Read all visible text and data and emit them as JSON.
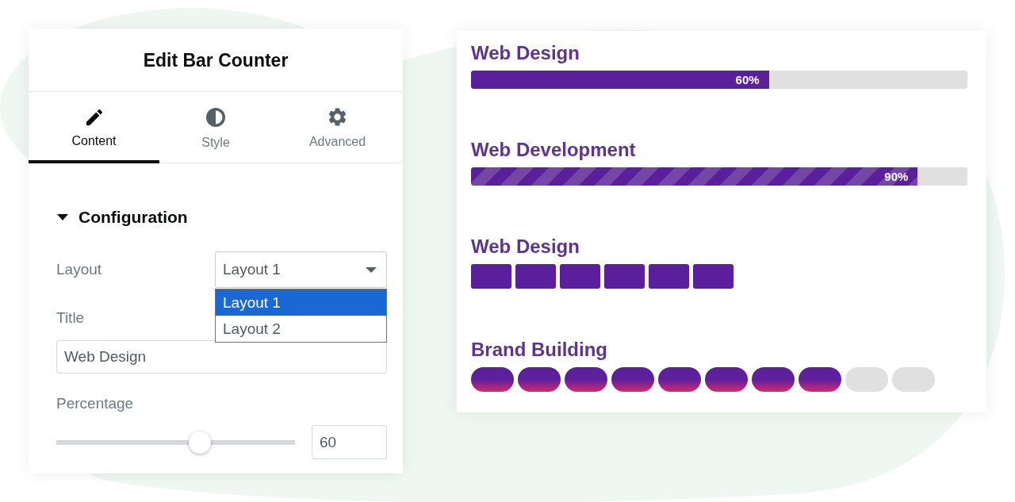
{
  "panel": {
    "title": "Edit Bar Counter",
    "tabs": [
      {
        "label": "Content",
        "selected": true
      },
      {
        "label": "Style",
        "selected": false
      },
      {
        "label": "Advanced",
        "selected": false
      }
    ],
    "section": {
      "title": "Configuration",
      "expanded": true,
      "fields": [
        {
          "kind": "select",
          "label": "Layout",
          "value": "Layout 1",
          "expanded": true,
          "options": [
            {
              "label": "Layout 1",
              "selected": true
            },
            {
              "label": "Layout 2",
              "selected": false
            }
          ]
        },
        {
          "kind": "text",
          "label": "Title",
          "value": "Web Design"
        },
        {
          "kind": "slider",
          "label": "Percentage",
          "level": 0.6,
          "value": "60"
        }
      ]
    }
  },
  "preview": {
    "bars": [
      {
        "kind": "solid",
        "title": "Web Design",
        "level": 0.6,
        "reading": "60%"
      },
      {
        "kind": "striped",
        "title": "Web Development",
        "level": 0.9,
        "reading": "90%"
      },
      {
        "kind": "blocks",
        "title": "Web Design",
        "segments": [
          {
            "filled": true
          },
          {
            "filled": true
          },
          {
            "filled": true
          },
          {
            "filled": true
          },
          {
            "filled": true
          },
          {
            "filled": true
          }
        ]
      },
      {
        "kind": "pills",
        "title": "Brand Building",
        "segments": [
          {
            "filled": true
          },
          {
            "filled": true
          },
          {
            "filled": true
          },
          {
            "filled": true
          },
          {
            "filled": true
          },
          {
            "filled": true
          },
          {
            "filled": true
          },
          {
            "filled": true
          },
          {
            "filled": false
          },
          {
            "filled": false
          }
        ]
      }
    ]
  }
}
